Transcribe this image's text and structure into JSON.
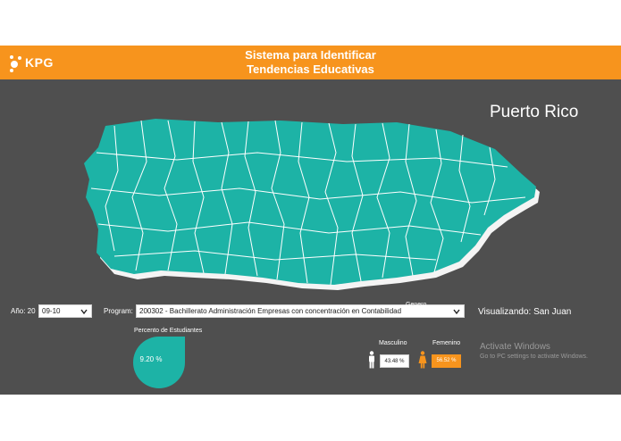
{
  "header": {
    "logo_text": "KPG",
    "title_line1": "Sistema para Identificar",
    "title_line2": "Tendencias Educativas"
  },
  "map": {
    "region_name": "Puerto Rico",
    "fill_color": "#1db3a6",
    "shadow_color": "#f4f4f4"
  },
  "filters": {
    "year_label": "Año: 20",
    "year_value": "09-10",
    "program_label": "Program:",
    "program_value": "200302 - Bachillerato Administración Empresas con concentración en Contabilidad"
  },
  "viewing": {
    "label": "Visualizando: San Juan"
  },
  "students": {
    "title": "Percento de Estudiantes",
    "value": "9.20 %"
  },
  "gender": {
    "title": "Genero",
    "male_label": "Masculino",
    "male_value": "43.48 %",
    "female_label": "Femenino",
    "female_value": "56.52 %"
  },
  "watermark": {
    "line1": "Activate Windows",
    "line2": "Go to PC settings to activate Windows."
  },
  "colors": {
    "accent": "#f7941d",
    "teal": "#1db3a6",
    "background": "#4f4f4f"
  }
}
